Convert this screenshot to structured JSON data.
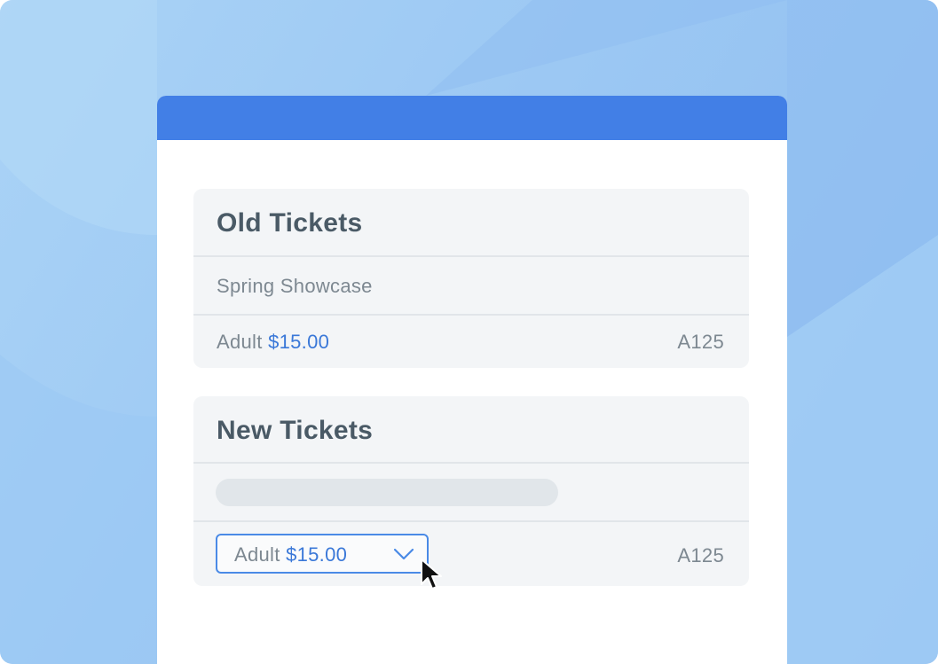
{
  "old_tickets": {
    "title": "Old Tickets",
    "event_name": "Spring Showcase",
    "ticket_type": "Adult",
    "price": "$15.00",
    "seat": "A125"
  },
  "new_tickets": {
    "title": "New Tickets",
    "event_name": "",
    "ticket_select": {
      "ticket_type": "Adult",
      "price": "$15.00"
    },
    "seat": "A125"
  },
  "colors": {
    "titlebar": "#427fe6",
    "price_accent": "#3a78d8",
    "select_border": "#4a8ae6"
  },
  "icons": [
    "chevron-down-icon",
    "mouse-cursor-icon"
  ]
}
